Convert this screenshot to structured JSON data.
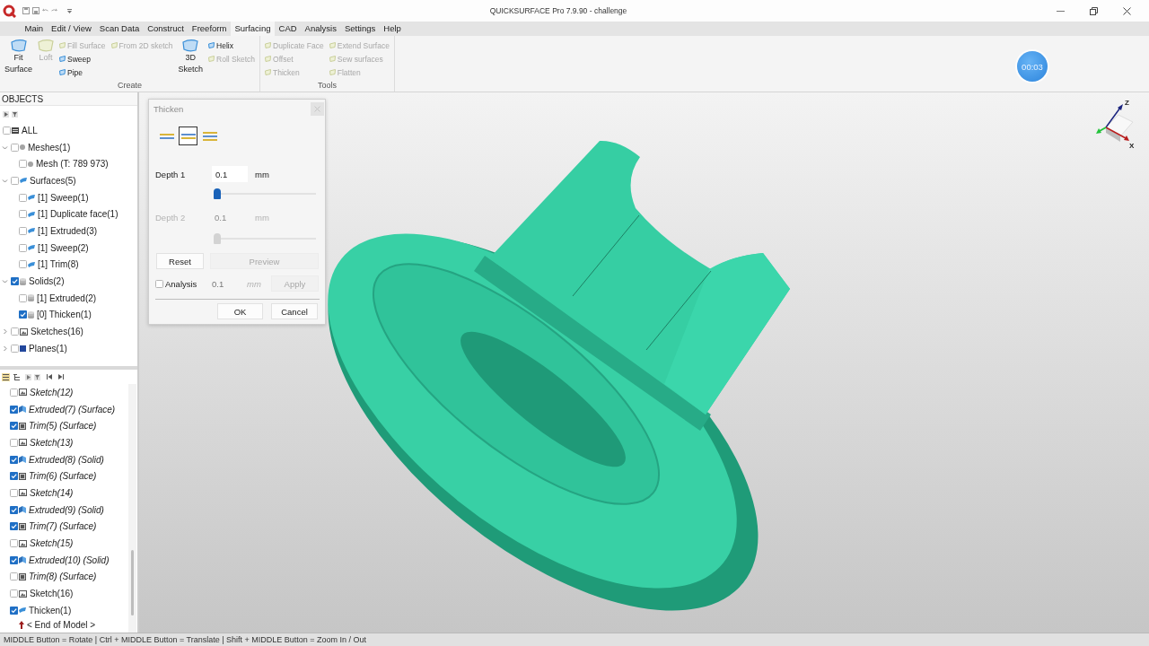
{
  "window": {
    "title": "QUICKSURFACE Pro 7.9.90 - challenge"
  },
  "menu_tabs": [
    {
      "label": "Main",
      "selected": false
    },
    {
      "label": "Edit / View",
      "selected": false
    },
    {
      "label": "Scan Data",
      "selected": false
    },
    {
      "label": "Construct",
      "selected": false
    },
    {
      "label": "Freeform",
      "selected": false
    },
    {
      "label": "Surfacing",
      "selected": true
    },
    {
      "label": "CAD",
      "selected": false
    },
    {
      "label": "Analysis",
      "selected": false
    },
    {
      "label": "Settings",
      "selected": false
    },
    {
      "label": "Help",
      "selected": false
    }
  ],
  "ribbon": {
    "groups": [
      {
        "label": "Create",
        "columns": [
          {
            "kind": "large",
            "tools": [
              {
                "label": "Fit Surface",
                "disabled": false
              }
            ]
          },
          {
            "kind": "large",
            "tools": [
              {
                "label": "Loft",
                "disabled": true
              }
            ]
          },
          {
            "kind": "stack",
            "tools": [
              {
                "label": "Fill Surface",
                "disabled": true
              },
              {
                "label": "Sweep",
                "disabled": false
              },
              {
                "label": "Pipe",
                "disabled": false
              }
            ]
          },
          {
            "kind": "stack",
            "tools": [
              {
                "label": "From 2D sketch",
                "disabled": true
              }
            ]
          },
          {
            "kind": "large",
            "tools": [
              {
                "label": "3D Sketch",
                "disabled": false
              }
            ]
          },
          {
            "kind": "stack",
            "tools": [
              {
                "label": "Helix",
                "disabled": false
              },
              {
                "label": "Roll Sketch",
                "disabled": true
              }
            ]
          }
        ]
      },
      {
        "label": "Tools",
        "columns": [
          {
            "kind": "stack",
            "tools": [
              {
                "label": "Duplicate Face",
                "disabled": true
              },
              {
                "label": "Offset",
                "disabled": true
              },
              {
                "label": "Thicken",
                "disabled": true
              }
            ]
          },
          {
            "kind": "stack",
            "tools": [
              {
                "label": "Extend Surface",
                "disabled": true
              },
              {
                "label": "Sew surfaces",
                "disabled": true
              },
              {
                "label": "Flatten",
                "disabled": true
              }
            ]
          }
        ]
      }
    ]
  },
  "timer": {
    "text": "00:03"
  },
  "objects_panel": {
    "title": "OBJECTS",
    "all": {
      "label": "ALL",
      "checked": false
    },
    "nodes": [
      {
        "label": "Meshes(1)",
        "kind": "mesh",
        "checked": false,
        "expanded": true,
        "children": [
          {
            "label": "Mesh (T: 789 973)",
            "kind": "mesh",
            "checked": false
          }
        ]
      },
      {
        "label": "Surfaces(5)",
        "kind": "surface",
        "checked": false,
        "expanded": true,
        "children": [
          {
            "label": "[1] Sweep(1)",
            "kind": "surface",
            "checked": false
          },
          {
            "label": "[1] Duplicate face(1)",
            "kind": "surface",
            "checked": false
          },
          {
            "label": "[1] Extruded(3)",
            "kind": "surface",
            "checked": false
          },
          {
            "label": "[1] Sweep(2)",
            "kind": "surface",
            "checked": false
          },
          {
            "label": "[1] Trim(8)",
            "kind": "surface",
            "checked": false
          }
        ]
      },
      {
        "label": "Solids(2)",
        "kind": "solid",
        "checked": true,
        "expanded": true,
        "children": [
          {
            "label": "[1] Extruded(2)",
            "kind": "solid",
            "checked": false
          },
          {
            "label": "[0] Thicken(1)",
            "kind": "solid",
            "checked": true
          }
        ]
      },
      {
        "label": "Sketches(16)",
        "kind": "sketch",
        "checked": false,
        "expanded": false
      },
      {
        "label": "Planes(1)",
        "kind": "plane",
        "checked": false,
        "expanded": false
      }
    ]
  },
  "history_panel": {
    "view_buttons": [
      {
        "kind": "list",
        "selected": true
      },
      {
        "kind": "tree",
        "selected": false
      }
    ],
    "items": [
      {
        "label": "Sketch(12)",
        "kind": "sketch",
        "checked": false,
        "italic": true
      },
      {
        "label": "Extruded(7) (Surface)",
        "kind": "extrude",
        "checked": true,
        "italic": true
      },
      {
        "label": "Trim(5) (Surface)",
        "kind": "trim",
        "checked": true,
        "italic": true
      },
      {
        "label": "Sketch(13)",
        "kind": "sketch",
        "checked": false,
        "italic": true
      },
      {
        "label": "Extruded(8) (Solid)",
        "kind": "extrude",
        "checked": true,
        "italic": true
      },
      {
        "label": "Trim(6) (Surface)",
        "kind": "trim",
        "checked": true,
        "italic": true
      },
      {
        "label": "Sketch(14)",
        "kind": "sketch",
        "checked": false,
        "italic": true
      },
      {
        "label": "Extruded(9) (Solid)",
        "kind": "extrude",
        "checked": true,
        "italic": true
      },
      {
        "label": "Trim(7) (Surface)",
        "kind": "trim",
        "checked": true,
        "italic": true
      },
      {
        "label": "Sketch(15)",
        "kind": "sketch",
        "checked": false,
        "italic": true
      },
      {
        "label": "Extruded(10) (Solid)",
        "kind": "extrude",
        "checked": true,
        "italic": true
      },
      {
        "label": "Trim(8) (Surface)",
        "kind": "trim",
        "checked": false,
        "italic": true
      },
      {
        "label": "Sketch(16)",
        "kind": "sketch",
        "checked": false,
        "italic": false
      },
      {
        "label": "Thicken(1)",
        "kind": "thicken",
        "checked": true,
        "italic": false
      }
    ],
    "end_marker": {
      "label": "< End of Model >"
    }
  },
  "thicken_dialog": {
    "title": "Thicken",
    "side_options": [
      {
        "kind": "one-side",
        "selected": false
      },
      {
        "kind": "other-side",
        "selected": true
      },
      {
        "kind": "both-sides",
        "selected": false
      }
    ],
    "depths": [
      {
        "label": "Depth 1",
        "value": "0.1",
        "unit": "mm",
        "level": 0,
        "disabled": false
      },
      {
        "label": "Depth 2",
        "value": "0.1",
        "unit": "mm",
        "level": 0,
        "disabled": true
      }
    ],
    "reset_button": {
      "label": "Reset",
      "disabled": false
    },
    "preview_button": {
      "label": "Preview",
      "disabled": true
    },
    "analysis": {
      "label": "Analysis",
      "checked": false,
      "value": "0.1",
      "unit": "mm"
    },
    "apply_button": {
      "label": "Apply",
      "disabled": true
    },
    "ok_button": {
      "label": "OK"
    },
    "cancel_button": {
      "label": "Cancel"
    }
  },
  "axis_triad": {
    "z_label": "Z",
    "x_label": "X"
  },
  "status_bar": {
    "text": "MIDDLE Button = Rotate | Ctrl + MIDDLE Button = Translate | Shift + MIDDLE Button = Zoom In / Out"
  }
}
